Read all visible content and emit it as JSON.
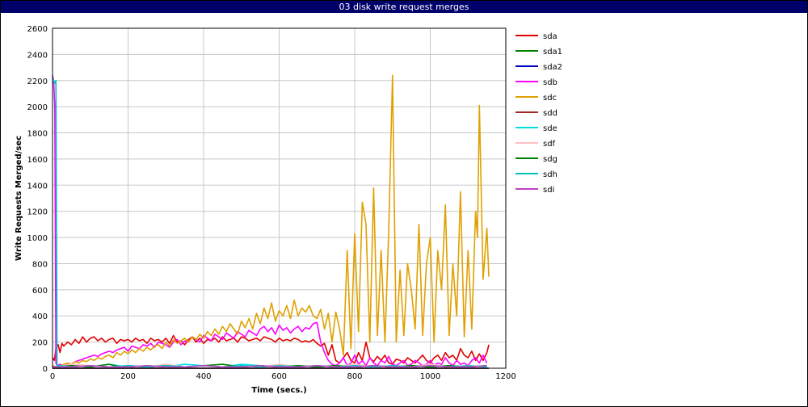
{
  "window": {
    "title": "03 disk write request merges"
  },
  "chart_data": {
    "type": "line",
    "title": "03 disk write request merges",
    "xlabel": "Time (secs.)",
    "ylabel": "Write Requests Merged/sec",
    "xlim": [
      0,
      1200
    ],
    "ylim": [
      0,
      2600
    ],
    "xticks": [
      0,
      200,
      400,
      600,
      800,
      1000,
      1200
    ],
    "yticks": [
      0,
      200,
      400,
      600,
      800,
      1000,
      1200,
      1400,
      1600,
      1800,
      2000,
      2200,
      2400,
      2600
    ],
    "grid": true,
    "legend_position": "right",
    "series": [
      {
        "name": "sda",
        "color": "#e00000",
        "x": [
          0,
          5,
          10,
          15,
          20,
          25,
          30,
          40,
          50,
          60,
          70,
          80,
          90,
          100,
          110,
          120,
          130,
          140,
          150,
          160,
          170,
          180,
          190,
          200,
          210,
          220,
          230,
          240,
          250,
          260,
          270,
          280,
          290,
          300,
          310,
          320,
          330,
          340,
          350,
          360,
          370,
          380,
          390,
          400,
          410,
          420,
          430,
          440,
          450,
          460,
          470,
          480,
          490,
          500,
          510,
          520,
          530,
          540,
          550,
          560,
          570,
          580,
          590,
          600,
          610,
          620,
          630,
          640,
          650,
          660,
          670,
          680,
          690,
          700,
          710,
          720,
          730,
          740,
          750,
          760,
          770,
          780,
          790,
          800,
          810,
          820,
          830,
          840,
          850,
          860,
          870,
          880,
          890,
          900,
          910,
          920,
          930,
          940,
          950,
          960,
          970,
          980,
          990,
          1000,
          1010,
          1020,
          1030,
          1040,
          1050,
          1060,
          1070,
          1080,
          1090,
          1100,
          1110,
          1120,
          1130,
          1140,
          1150,
          1155
        ],
        "y": [
          80,
          60,
          170,
          180,
          120,
          190,
          170,
          200,
          180,
          220,
          190,
          240,
          200,
          230,
          240,
          210,
          230,
          200,
          220,
          230,
          190,
          220,
          210,
          220,
          200,
          230,
          210,
          220,
          190,
          230,
          210,
          220,
          200,
          230,
          190,
          250,
          200,
          210,
          180,
          220,
          240,
          200,
          230,
          190,
          220,
          210,
          230,
          200,
          240,
          210,
          220,
          230,
          200,
          240,
          230,
          210,
          220,
          230,
          210,
          240,
          230,
          220,
          200,
          230,
          210,
          220,
          210,
          230,
          220,
          200,
          210,
          200,
          220,
          190,
          170,
          190,
          100,
          180,
          60,
          40,
          80,
          120,
          60,
          40,
          120,
          60,
          200,
          80,
          50,
          90,
          60,
          100,
          40,
          30,
          70,
          60,
          40,
          80,
          60,
          40,
          70,
          100,
          60,
          40,
          80,
          100,
          60,
          120,
          80,
          100,
          60,
          150,
          100,
          80,
          130,
          60,
          110,
          60,
          120,
          180
        ]
      },
      {
        "name": "sda1",
        "color": "#008000",
        "x": [
          0,
          100,
          200,
          300,
          400,
          500,
          600,
          700,
          800,
          900,
          1000,
          1100,
          1155
        ],
        "y": [
          0,
          0,
          0,
          0,
          0,
          0,
          0,
          0,
          0,
          0,
          0,
          0,
          0
        ]
      },
      {
        "name": "sda2",
        "color": "#0000c0",
        "x": [
          0,
          100,
          200,
          300,
          400,
          500,
          600,
          700,
          800,
          900,
          1000,
          1100,
          1155
        ],
        "y": [
          0,
          0,
          0,
          0,
          0,
          0,
          0,
          0,
          0,
          0,
          0,
          0,
          0
        ]
      },
      {
        "name": "sdb",
        "color": "#ff00ff",
        "x": [
          0,
          3,
          6,
          9,
          12,
          20,
          30,
          40,
          50,
          60,
          70,
          80,
          90,
          100,
          110,
          120,
          130,
          140,
          150,
          160,
          170,
          180,
          190,
          200,
          210,
          220,
          230,
          240,
          250,
          260,
          270,
          280,
          290,
          300,
          310,
          320,
          330,
          340,
          350,
          360,
          370,
          380,
          390,
          400,
          410,
          420,
          430,
          440,
          450,
          460,
          470,
          480,
          490,
          500,
          510,
          520,
          530,
          540,
          550,
          560,
          570,
          580,
          590,
          600,
          610,
          620,
          630,
          640,
          650,
          660,
          670,
          680,
          690,
          700,
          710,
          720,
          730,
          740,
          750,
          760,
          770,
          780,
          790,
          800,
          810,
          820,
          830,
          840,
          850,
          860,
          870,
          880,
          890,
          900,
          910,
          920,
          930,
          940,
          950,
          960,
          970,
          980,
          990,
          1000,
          1010,
          1020,
          1030,
          1040,
          1050,
          1060,
          1070,
          1080,
          1090,
          1100,
          1110,
          1120,
          1130,
          1140,
          1150
        ],
        "y": [
          2240,
          2200,
          2000,
          40,
          20,
          30,
          20,
          40,
          30,
          50,
          60,
          70,
          80,
          90,
          100,
          90,
          110,
          120,
          130,
          120,
          140,
          150,
          160,
          130,
          170,
          160,
          150,
          180,
          170,
          190,
          160,
          200,
          190,
          180,
          160,
          200,
          220,
          180,
          210,
          200,
          240,
          220,
          200,
          250,
          230,
          210,
          260,
          240,
          220,
          270,
          250,
          230,
          280,
          260,
          240,
          290,
          270,
          250,
          300,
          320,
          280,
          310,
          260,
          330,
          290,
          310,
          270,
          300,
          320,
          280,
          310,
          300,
          340,
          350,
          200,
          120,
          60,
          30,
          20,
          40,
          80,
          20,
          40,
          100,
          30,
          60,
          20,
          80,
          40,
          20,
          60,
          40,
          90,
          30,
          20,
          40,
          60,
          20,
          30,
          60,
          40,
          20,
          30,
          60,
          20,
          40,
          30,
          80,
          40,
          20,
          60,
          30,
          40,
          20,
          60,
          80,
          40,
          100,
          40
        ]
      },
      {
        "name": "sdc",
        "color": "#e0a000",
        "x": [
          0,
          10,
          20,
          30,
          40,
          50,
          60,
          70,
          80,
          90,
          100,
          110,
          120,
          130,
          140,
          150,
          160,
          170,
          180,
          190,
          200,
          210,
          220,
          230,
          240,
          250,
          260,
          270,
          280,
          290,
          300,
          310,
          320,
          330,
          340,
          350,
          360,
          370,
          380,
          390,
          400,
          410,
          420,
          430,
          440,
          450,
          460,
          470,
          480,
          490,
          500,
          510,
          520,
          530,
          540,
          550,
          560,
          570,
          580,
          590,
          600,
          610,
          620,
          630,
          640,
          650,
          660,
          670,
          680,
          690,
          700,
          710,
          720,
          730,
          740,
          750,
          760,
          770,
          780,
          790,
          800,
          810,
          820,
          830,
          840,
          850,
          860,
          870,
          880,
          890,
          900,
          910,
          920,
          930,
          940,
          950,
          960,
          970,
          980,
          990,
          1000,
          1010,
          1020,
          1030,
          1040,
          1050,
          1060,
          1070,
          1080,
          1090,
          1100,
          1110,
          1120,
          1125,
          1130,
          1140,
          1150,
          1155
        ],
        "y": [
          20,
          10,
          20,
          30,
          40,
          30,
          50,
          40,
          60,
          50,
          70,
          60,
          80,
          70,
          90,
          100,
          80,
          120,
          100,
          130,
          110,
          140,
          120,
          150,
          130,
          160,
          140,
          170,
          180,
          150,
          200,
          170,
          220,
          190,
          210,
          230,
          200,
          240,
          220,
          260,
          230,
          280,
          250,
          300,
          260,
          320,
          280,
          340,
          300,
          260,
          360,
          310,
          380,
          300,
          420,
          340,
          460,
          380,
          500,
          360,
          440,
          400,
          480,
          380,
          520,
          400,
          460,
          430,
          480,
          400,
          380,
          450,
          300,
          420,
          200,
          430,
          300,
          100,
          900,
          150,
          1030,
          280,
          1270,
          1100,
          200,
          1380,
          250,
          900,
          200,
          1050,
          2240,
          200,
          750,
          250,
          800,
          600,
          300,
          1100,
          250,
          800,
          1000,
          200,
          900,
          600,
          1250,
          250,
          800,
          400,
          1350,
          240,
          900,
          300,
          1200,
          1000,
          2010,
          680,
          1070,
          700
        ]
      },
      {
        "name": "sdd",
        "color": "#a52a2a",
        "x": [
          0,
          100,
          200,
          300,
          400,
          500,
          600,
          700,
          800,
          900,
          1000,
          1100,
          1155
        ],
        "y": [
          0,
          0,
          0,
          0,
          0,
          0,
          0,
          0,
          0,
          0,
          0,
          0,
          0
        ]
      },
      {
        "name": "sde",
        "color": "#00e0e0",
        "x": [
          0,
          50,
          100,
          150,
          200,
          250,
          300,
          350,
          400,
          450,
          500,
          550,
          600,
          650,
          700,
          750,
          800,
          850,
          900,
          950,
          1000,
          1050,
          1100,
          1150
        ],
        "y": [
          10,
          20,
          10,
          30,
          10,
          20,
          10,
          30,
          20,
          10,
          30,
          20,
          10,
          20,
          10,
          20,
          10,
          20,
          10,
          20,
          10,
          20,
          10,
          20
        ]
      },
      {
        "name": "sdf",
        "color": "#ffc0c0",
        "x": [
          0,
          50,
          100,
          150,
          200,
          250,
          300,
          350,
          400,
          450,
          500,
          550,
          600,
          650,
          700,
          750,
          800,
          850,
          900,
          950,
          1000,
          1050,
          1100,
          1150
        ],
        "y": [
          10,
          30,
          20,
          10,
          20,
          10,
          30,
          10,
          20,
          10,
          20,
          10,
          30,
          10,
          20,
          10,
          30,
          10,
          20,
          10,
          30,
          10,
          20,
          10
        ]
      },
      {
        "name": "sdg",
        "color": "#008000",
        "x": [
          0,
          50,
          100,
          150,
          180,
          200,
          250,
          300,
          350,
          400,
          450,
          500,
          550,
          600,
          650,
          700,
          750,
          800,
          850,
          900,
          950,
          1000,
          1050,
          1100,
          1150
        ],
        "y": [
          10,
          20,
          10,
          30,
          10,
          20,
          10,
          20,
          10,
          20,
          30,
          10,
          20,
          10,
          20,
          10,
          20,
          10,
          20,
          10,
          20,
          10,
          20,
          10,
          20
        ]
      },
      {
        "name": "sdh",
        "color": "#00c0c0",
        "x": [
          0,
          3,
          6,
          9,
          12,
          20,
          50,
          100,
          150,
          200,
          250,
          300,
          350,
          400,
          450,
          500,
          550,
          600,
          650,
          700,
          750,
          800,
          850,
          900,
          950,
          1000,
          1050,
          1100,
          1150
        ],
        "y": [
          2220,
          2200,
          2180,
          2200,
          20,
          20,
          10,
          20,
          10,
          20,
          10,
          20,
          10,
          20,
          10,
          20,
          10,
          20,
          10,
          20,
          10,
          20,
          10,
          20,
          10,
          20,
          10,
          20,
          10
        ]
      },
      {
        "name": "sdi",
        "color": "#c040c0",
        "x": [
          0,
          50,
          100,
          150,
          200,
          250,
          300,
          350,
          400,
          450,
          500,
          550,
          600,
          650,
          700,
          750,
          800,
          850,
          900,
          950,
          1000,
          1050,
          1100,
          1150
        ],
        "y": [
          10,
          10,
          20,
          10,
          10,
          20,
          10,
          10,
          20,
          10,
          10,
          20,
          10,
          10,
          20,
          10,
          10,
          20,
          10,
          10,
          20,
          10,
          10,
          20
        ]
      }
    ]
  }
}
